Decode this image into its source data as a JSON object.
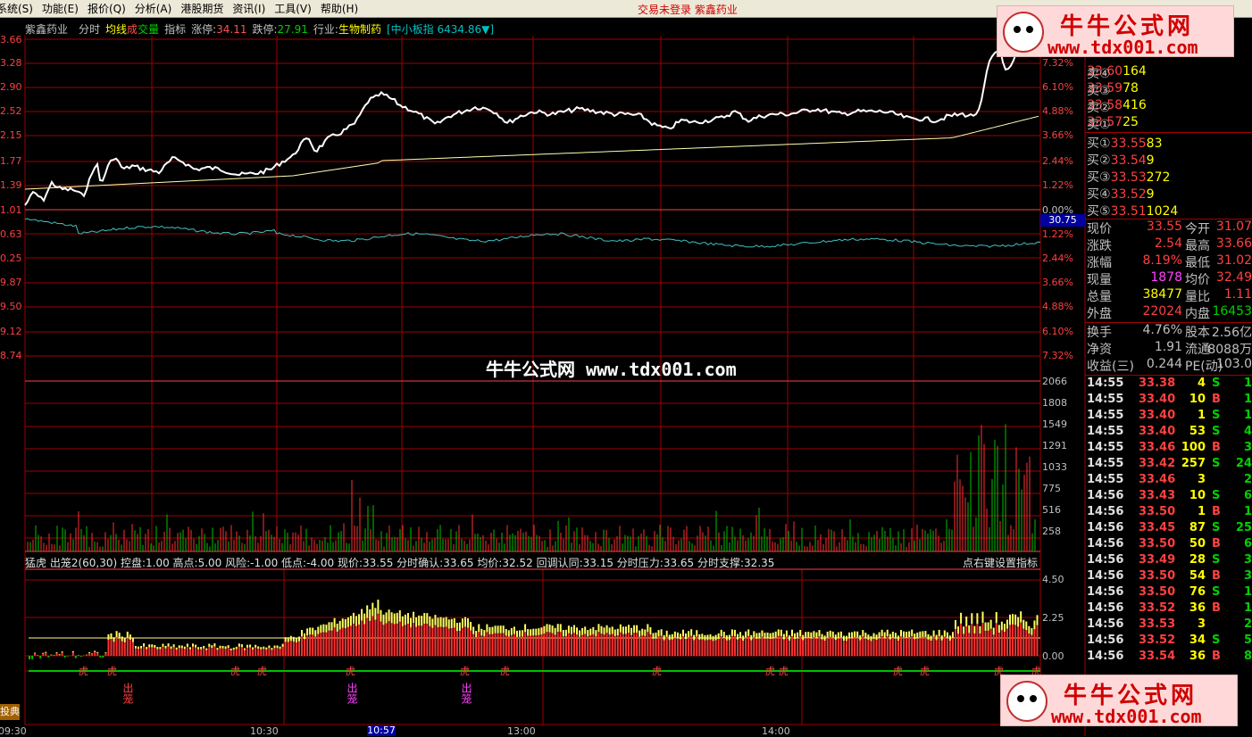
{
  "menu": [
    "系统(S)",
    "功能(E)",
    "报价(Q)",
    "分析(A)",
    "港股期货",
    "资讯(I)",
    "工具(V)",
    "帮助(H)"
  ],
  "window_title": "交易未登录  紫鑫药业",
  "header": {
    "stock_name": "紫鑫药业",
    "tab_fenshi": "分时",
    "tab_junxian": "均线",
    "tab_cheng": "成",
    "tab_jiaoliang": "交量",
    "tab_zhibiao": "指标",
    "zhangting_label": "涨停:",
    "zhangting_value": "34.11",
    "dieting_label": "跌停:",
    "dieting_value": "27.91",
    "industry_label": "行业:",
    "industry_value": "生物制药",
    "board": "[中小板指 6434.86▼]"
  },
  "left_price_scale": [
    "3.66",
    "3.28",
    "2.90",
    "2.52",
    "2.15",
    "1.77",
    "1.39",
    "1.01",
    "0.63",
    "0.25",
    "9.87",
    "9.50",
    "9.12",
    "8.74"
  ],
  "right_pct_scale": [
    "7.32%",
    "6.10%",
    "4.88%",
    "3.66%",
    "2.44%",
    "1.22%",
    "0.00%",
    "1.22%",
    "2.44%",
    "3.66%",
    "4.88%",
    "6.10%",
    "7.32%"
  ],
  "pct_highlight": "30.75",
  "volume_scale": [
    "2066",
    "1808",
    "1549",
    "1291",
    "1033",
    "775",
    "516",
    "258"
  ],
  "indicator_scale": [
    "4.50",
    "2.25",
    "0.00"
  ],
  "indicator_legend": "猛虎 出笼2(60,30)  控盘:1.00  高点:5.00  风险:-1.00  低点:-4.00  现价:33.55  分时确认:33.65  均价:32.52  回调认同:33.15  分时压力:33.65  分时支撑:32.35",
  "indicator_right": "点右键设置指标",
  "time_axis": [
    "09:30",
    "10:30",
    "10:57",
    "13:00",
    "14:00"
  ],
  "bottom_left_label": "投典",
  "center_watermark": "牛牛公式网 www.tdx001.com",
  "banner": {
    "title": "牛牛公式网",
    "url": "www.tdx001.com"
  },
  "tag_tiger": "虎",
  "tag_chulong": "出笼",
  "quotes_sell": [
    {
      "label": "卖④",
      "price": "33.60",
      "vol": "164"
    },
    {
      "label": "卖③",
      "price": "33.59",
      "vol": "78"
    },
    {
      "label": "卖②",
      "price": "33.58",
      "vol": "416"
    },
    {
      "label": "卖①",
      "price": "33.57",
      "vol": "25"
    }
  ],
  "quotes_buy": [
    {
      "label": "买①",
      "price": "33.55",
      "vol": "83"
    },
    {
      "label": "买②",
      "price": "33.54",
      "vol": "9"
    },
    {
      "label": "买③",
      "price": "33.53",
      "vol": "272"
    },
    {
      "label": "买④",
      "price": "33.52",
      "vol": "9"
    },
    {
      "label": "买⑤",
      "price": "33.51",
      "vol": "1024"
    }
  ],
  "stats": [
    {
      "l1": "现价",
      "v1": "33.55",
      "l2": "今开",
      "v2": "31.07",
      "c1": "#ff4040",
      "c2": "#ff4040"
    },
    {
      "l1": "涨跌",
      "v1": "2.54",
      "l2": "最高",
      "v2": "33.66",
      "c1": "#ff4040",
      "c2": "#ff4040"
    },
    {
      "l1": "涨幅",
      "v1": "8.19%",
      "l2": "最低",
      "v2": "31.02",
      "c1": "#ff4040",
      "c2": "#ff4040"
    },
    {
      "l1": "现量",
      "v1": "1878",
      "l2": "均价",
      "v2": "32.49",
      "c1": "#ff40ff",
      "c2": "#ff4040"
    },
    {
      "l1": "总量",
      "v1": "38477",
      "l2": "量比",
      "v2": "1.11",
      "c1": "#ffff00",
      "c2": "#ff4040"
    },
    {
      "l1": "外盘",
      "v1": "22024",
      "l2": "内盘",
      "v2": "16453",
      "c1": "#ff4040",
      "c2": "#00d000"
    },
    {
      "l1": "换手",
      "v1": "4.76%",
      "l2": "股本",
      "v2": "2.56亿",
      "c1": "#c0c0c0",
      "c2": "#c0c0c0"
    },
    {
      "l1": "净资",
      "v1": "1.91",
      "l2": "流通",
      "v2": "8088万",
      "c1": "#c0c0c0",
      "c2": "#c0c0c0"
    },
    {
      "l1": "收益(三)",
      "v1": "0.244",
      "l2": "PE(动)",
      "v2": "103.0",
      "c1": "#c0c0c0",
      "c2": "#c0c0c0"
    }
  ],
  "ticks": [
    {
      "t": "14:55",
      "p": "33.38",
      "v": "4",
      "bs": "S",
      "n": "1"
    },
    {
      "t": "14:55",
      "p": "33.40",
      "v": "10",
      "bs": "B",
      "n": "1"
    },
    {
      "t": "14:55",
      "p": "33.40",
      "v": "1",
      "bs": "S",
      "n": "1"
    },
    {
      "t": "14:55",
      "p": "33.40",
      "v": "53",
      "bs": "S",
      "n": "4"
    },
    {
      "t": "14:55",
      "p": "33.46",
      "v": "100",
      "bs": "B",
      "n": "3"
    },
    {
      "t": "14:55",
      "p": "33.42",
      "v": "257",
      "bs": "S",
      "n": "24"
    },
    {
      "t": "14:55",
      "p": "33.46",
      "v": "3",
      "bs": "",
      "n": "2"
    },
    {
      "t": "14:56",
      "p": "33.43",
      "v": "10",
      "bs": "S",
      "n": "6"
    },
    {
      "t": "14:56",
      "p": "33.50",
      "v": "1",
      "bs": "B",
      "n": "1"
    },
    {
      "t": "14:56",
      "p": "33.45",
      "v": "87",
      "bs": "S",
      "n": "25"
    },
    {
      "t": "14:56",
      "p": "33.50",
      "v": "50",
      "bs": "B",
      "n": "6"
    },
    {
      "t": "14:56",
      "p": "33.49",
      "v": "28",
      "bs": "S",
      "n": "3"
    },
    {
      "t": "14:56",
      "p": "33.50",
      "v": "54",
      "bs": "B",
      "n": "3"
    },
    {
      "t": "14:56",
      "p": "33.50",
      "v": "76",
      "bs": "S",
      "n": "1"
    },
    {
      "t": "14:56",
      "p": "33.52",
      "v": "36",
      "bs": "B",
      "n": "1"
    },
    {
      "t": "14:56",
      "p": "33.53",
      "v": "3",
      "bs": "",
      "n": "2"
    },
    {
      "t": "14:56",
      "p": "33.52",
      "v": "34",
      "bs": "S",
      "n": "5"
    },
    {
      "t": "14:56",
      "p": "33.54",
      "v": "36",
      "bs": "B",
      "n": "8"
    }
  ],
  "colors": {
    "grid": "#a00000",
    "price": "#ffffff",
    "avg": "#ffffb0",
    "cyan": "#40c0c0",
    "up": "#ff3030",
    "down": "#00c000",
    "yellow": "#ffff60"
  }
}
